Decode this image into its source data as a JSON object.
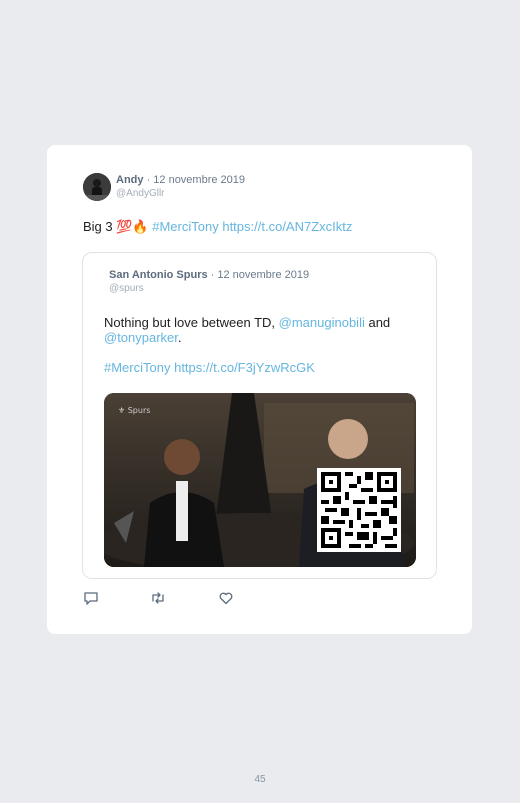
{
  "tweet": {
    "author_name": "Andy",
    "date": "· 12 novembre 2019",
    "handle": "@AndyGllr",
    "text_prefix": "Big 3 💯🔥",
    "hashtag": "#MerciTony",
    "link": "https://t.co/AN7ZxcIktz"
  },
  "quoted": {
    "author_name": "San Antonio Spurs",
    "date": "· 12 novembre 2019",
    "handle": "@spurs",
    "text_part1": "Nothing but love between TD, ",
    "mention1": "@manuginobili",
    "text_part2": " and",
    "mention2": "@tonyparker",
    "text_part3": ".",
    "hashtag": "#MerciTony",
    "link": "https://t.co/F3jYzwRcGK"
  },
  "actions": {
    "reply_icon": "reply-icon",
    "retweet_icon": "retweet-icon",
    "like_icon": "heart-icon"
  },
  "page_number": "45"
}
